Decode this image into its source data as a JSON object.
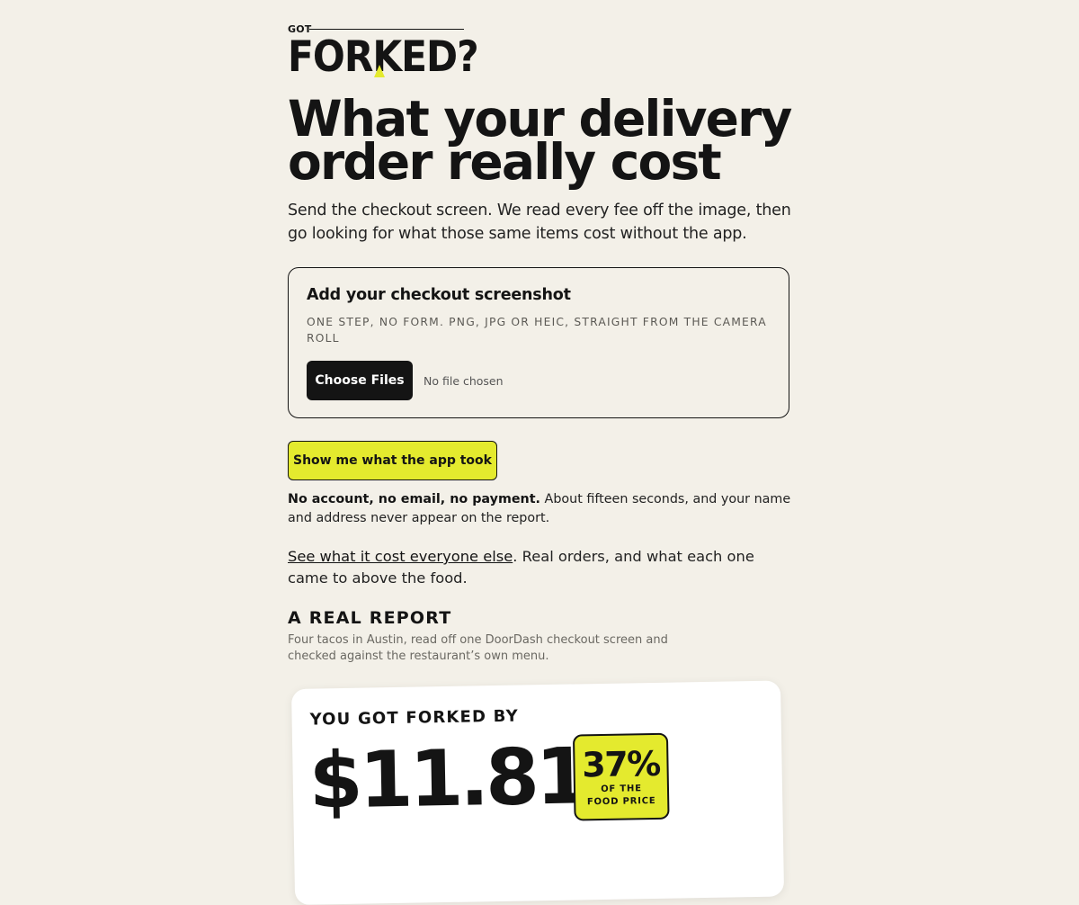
{
  "logo": {
    "top_word": "GOT",
    "main_word": "FORKED?"
  },
  "hero": {
    "title": "What your delivery order really cost",
    "subtitle": "Send the checkout screen. We read every fee off the image, then go looking for what those same items cost without the app."
  },
  "upload": {
    "title": "Add your checkout screenshot",
    "hint": "One step, no form. PNG, JPG or HEIC, straight from the camera roll",
    "choose_label": "Choose Files",
    "no_file_text": "No file chosen"
  },
  "cta": {
    "label": "Show me what the app took"
  },
  "privacy": {
    "bold": "No account, no email, no payment.",
    "rest": " About fifteen seconds, and your name and address never appear on the report."
  },
  "others": {
    "link": "See what it cost everyone else",
    "rest": ". Real orders, and what each one came to above the food."
  },
  "report": {
    "heading": "A REAL REPORT",
    "description": "Four tacos in Austin, read off one DoorDash checkout screen and checked against the restaurant’s own menu.",
    "label": "YOU GOT FORKED BY",
    "amount": "$11.81",
    "percent": "37%",
    "percent_label_1": "OF THE",
    "percent_label_2": "FOOD PRICE"
  },
  "colors": {
    "background": "#f3f0e8",
    "accent": "#e4ea2e",
    "ink": "#141414"
  }
}
